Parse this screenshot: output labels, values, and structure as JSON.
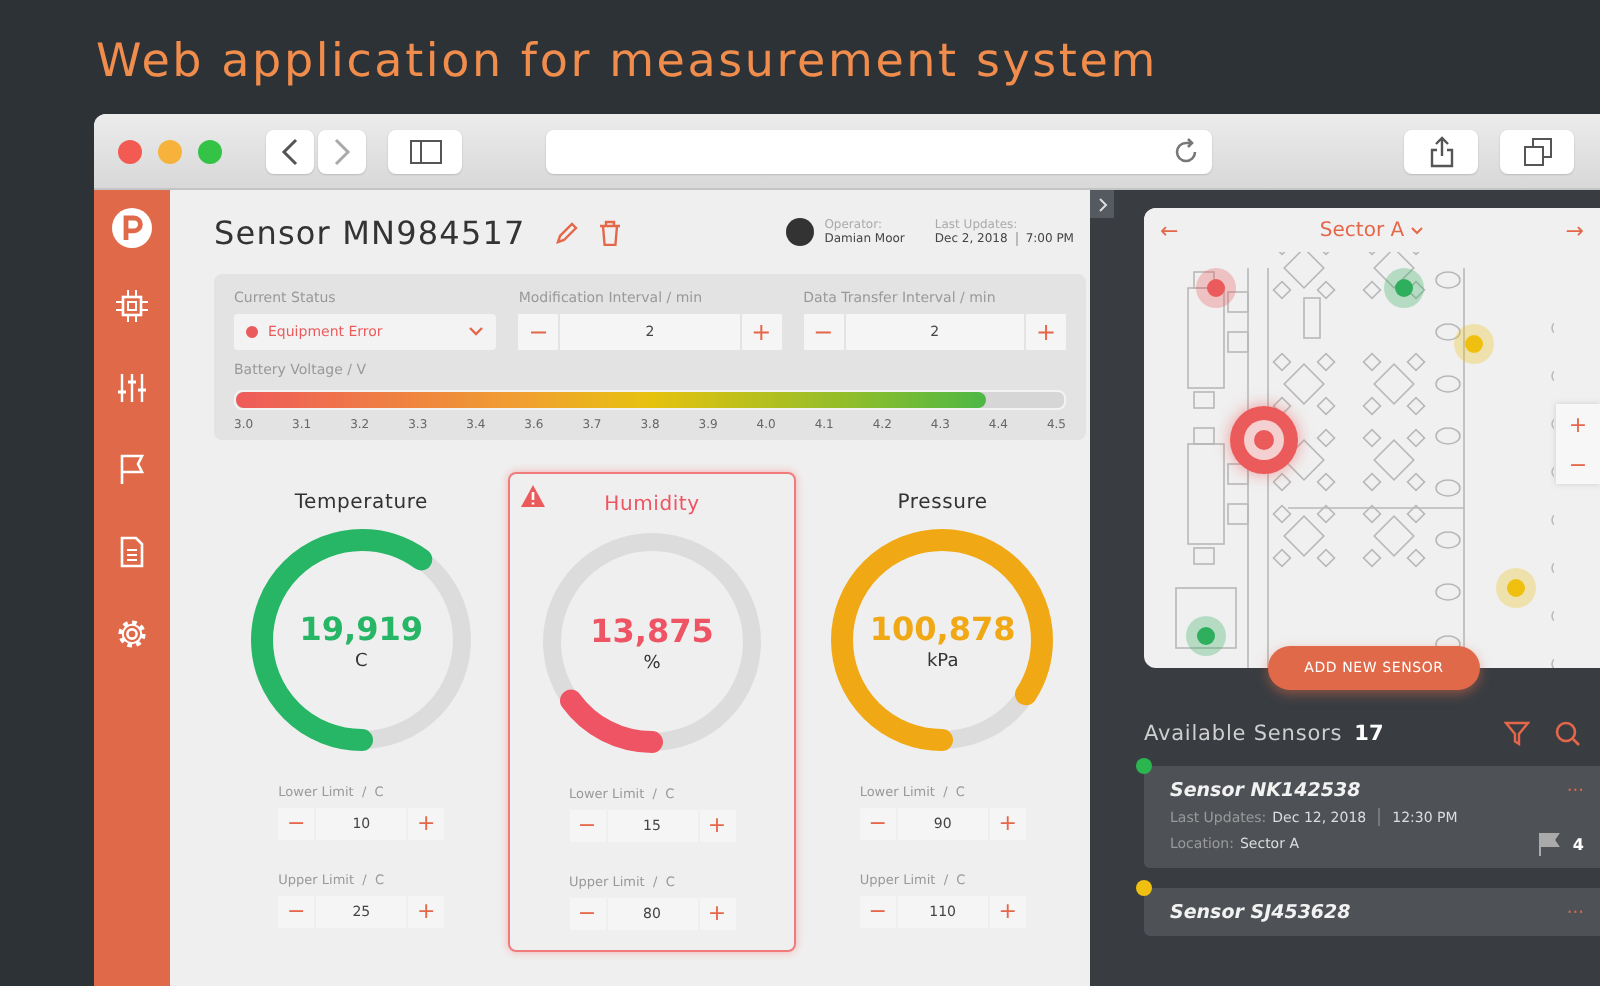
{
  "page_title": "Web application for measurement system",
  "sensor": {
    "title": "Sensor MN984517",
    "operator_label": "Operator:",
    "operator": "Damian Moor",
    "updated_label": "Last Updates:",
    "updated_date": "Dec 2, 2018",
    "updated_time": "7:00 PM"
  },
  "settings": {
    "status": {
      "label": "Current Status",
      "value": "Equipment Error",
      "color": "#ec5b5b"
    },
    "intervals": [
      {
        "label": "Modification Interval / min",
        "value": "2",
        "minus": "−",
        "plus": "+"
      },
      {
        "label": "Data Transfer Interval / min",
        "value": "2",
        "minus": "−",
        "plus": "+"
      }
    ],
    "battery": {
      "label": "Battery Voltage / V",
      "level": 0.906,
      "ticks": [
        "3.0",
        "3.1",
        "3.2",
        "3.3",
        "3.4",
        "3.6",
        "3.7",
        "3.8",
        "3.9",
        "4.0",
        "4.1",
        "4.2",
        "4.3",
        "4.4",
        "4.5"
      ]
    }
  },
  "gauges": [
    {
      "title": "Temperature",
      "value": "19,919",
      "unit": "C",
      "level": 0.6,
      "color": "#27b566",
      "alert": false,
      "limits": [
        {
          "label": "Lower Limit  /  C",
          "value": "10",
          "minus": "−",
          "plus": "+"
        },
        {
          "label": "Upper Limit  /  C",
          "value": "25",
          "minus": "−",
          "plus": "+"
        }
      ]
    },
    {
      "title": "Humidity",
      "value": "13,875",
      "unit": "%",
      "level": 0.15,
      "color": "#ee5463",
      "alert": true,
      "limits": [
        {
          "label": "Lower Limit  /  C",
          "value": "15",
          "minus": "−",
          "plus": "+"
        },
        {
          "label": "Upper Limit  /  C",
          "value": "80",
          "minus": "−",
          "plus": "+"
        }
      ]
    },
    {
      "title": "Pressure",
      "value": "100,878",
      "unit": "kPa",
      "level": 0.84,
      "color": "#f0a814",
      "alert": false,
      "limits": [
        {
          "label": "Lower Limit  /  C",
          "value": "90",
          "minus": "−",
          "plus": "+"
        },
        {
          "label": "Upper Limit  /  C",
          "value": "110",
          "minus": "−",
          "plus": "+"
        }
      ]
    }
  ],
  "map": {
    "sector": "Sector A",
    "prev": "←",
    "next": "→",
    "zoom_in": "+",
    "zoom_out": "−",
    "add_button": "ADD NEW SENSOR",
    "markers": [
      {
        "color": "#ec5b5b",
        "selected": false
      },
      {
        "color": "#2fae5e",
        "selected": false
      },
      {
        "color": "#f0c010",
        "selected": false
      },
      {
        "color": "#ec5b5b",
        "selected": true
      },
      {
        "color": "#f0c010",
        "selected": false
      },
      {
        "color": "#2fae5e",
        "selected": false
      }
    ]
  },
  "sensors": {
    "title": "Available Sensors",
    "count": "17",
    "menu": "···",
    "items": [
      {
        "name": "Sensor NK142538",
        "color": "#2bb54f",
        "updated_label": "Last Updates:",
        "date": "Dec 12, 2018",
        "time": "12:30 PM",
        "location_label": "Location:",
        "location": "Sector A",
        "flags": "4"
      },
      {
        "name": "Sensor SJ453628",
        "color": "#f0c010"
      }
    ]
  }
}
